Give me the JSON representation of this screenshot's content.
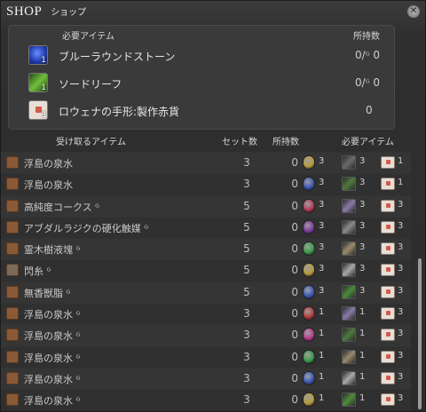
{
  "title": {
    "main": "SHOP",
    "sub": "ショップ"
  },
  "required": {
    "header_item": "必要アイテム",
    "header_owned": "所持数",
    "items": [
      {
        "name": "ブルーラウンドストーン",
        "count": "1",
        "owned": "0",
        "owned_hq": "0",
        "icon": "blue-stone-icon"
      },
      {
        "name": "ソードリーフ",
        "count": "1",
        "owned": "0",
        "owned_hq": "0",
        "icon": "leaf-icon"
      },
      {
        "name": "ロウェナの手形:製作赤貨",
        "count": "3",
        "owned": "0",
        "owned_hq": "",
        "icon": "scrip-envelope-icon"
      }
    ]
  },
  "list_headers": {
    "receive": "受け取るアイテム",
    "set": "セット数",
    "owned": "所持数",
    "required": "必要アイテム"
  },
  "hq_symbol": "ᴳ",
  "rows": [
    {
      "name": "浮島の泉水",
      "set": "3",
      "own": "0",
      "g1": "3",
      "g2": "3",
      "g3": "1",
      "gem": "#b79a3c",
      "mat": "#6b6b6b",
      "hl": false
    },
    {
      "name": "浮島の泉水",
      "set": "3",
      "own": "0",
      "g1": "3",
      "g2": "3",
      "g3": "1",
      "gem": "#3b59b8",
      "mat": "#4e7a3c",
      "hl": false
    },
    {
      "name": "高純度コークス",
      "set": "5",
      "own": "0",
      "g1": "3",
      "g2": "3",
      "g3": "3",
      "gem": "#b33a5a",
      "mat": "#8a7aa8",
      "hl": false,
      "hq": true
    },
    {
      "name": "アブダルラジクの硬化触媒",
      "set": "5",
      "own": "0",
      "g1": "3",
      "g2": "3",
      "g3": "3",
      "gem": "#7a3b9e",
      "mat": "#8a8a8a",
      "hl": false,
      "hq": true
    },
    {
      "name": "霊木樹液塊",
      "set": "5",
      "own": "0",
      "g1": "3",
      "g2": "3",
      "g3": "3",
      "gem": "#3b9a4a",
      "mat": "#9a8a6a",
      "hl": false,
      "hq": true
    },
    {
      "name": "閃糸",
      "set": "5",
      "own": "0",
      "g1": "3",
      "g2": "3",
      "g3": "3",
      "gem": "#b79a3c",
      "mat": "#a8a8a8",
      "hl": false,
      "hq": true,
      "icon": "rock"
    },
    {
      "name": "無香獣脂",
      "set": "5",
      "own": "0",
      "g1": "3",
      "g2": "3",
      "g3": "3",
      "gem": "#3b59b8",
      "mat": "#4e8a3c",
      "hl": false,
      "hq": true
    },
    {
      "name": "浮島の泉水",
      "set": "3",
      "own": "0",
      "g1": "1",
      "g2": "1",
      "g3": "3",
      "gem": "#b33a3a",
      "mat": "#8a7aa8",
      "hl": false,
      "hq": true
    },
    {
      "name": "浮島の泉水",
      "set": "3",
      "own": "0",
      "g1": "1",
      "g2": "1",
      "g3": "3",
      "gem": "#b33a8a",
      "mat": "#4e7a3c",
      "hl": false,
      "hq": true
    },
    {
      "name": "浮島の泉水",
      "set": "3",
      "own": "0",
      "g1": "1",
      "g2": "1",
      "g3": "3",
      "gem": "#3b9a4a",
      "mat": "#9a8a6a",
      "hl": false,
      "hq": true
    },
    {
      "name": "浮島の泉水",
      "set": "3",
      "own": "0",
      "g1": "1",
      "g2": "1",
      "g3": "3",
      "gem": "#3b59b8",
      "mat": "#a8a8a8",
      "hl": false,
      "hq": true
    },
    {
      "name": "浮島の泉水",
      "set": "3",
      "own": "0",
      "g1": "1",
      "g2": "1",
      "g3": "3",
      "gem": "#b79a3c",
      "mat": "#4e8a3c",
      "hl": false,
      "hq": true
    }
  ]
}
